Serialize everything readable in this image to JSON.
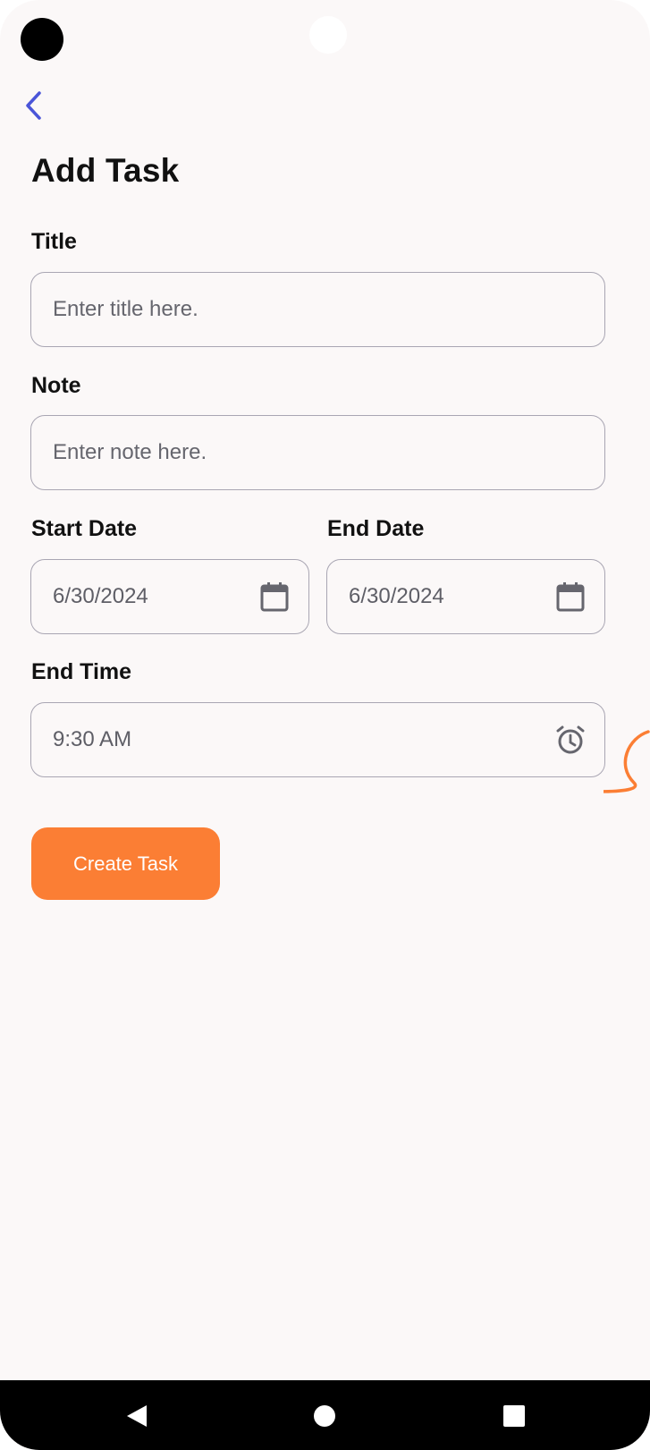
{
  "header": {
    "title": "Add Task"
  },
  "form": {
    "title": {
      "label": "Title",
      "placeholder": "Enter title here."
    },
    "note": {
      "label": "Note",
      "placeholder": "Enter note here."
    },
    "start_date": {
      "label": "Start Date",
      "value": "6/30/2024"
    },
    "end_date": {
      "label": "End Date",
      "value": "6/30/2024"
    },
    "end_time": {
      "label": "End Time",
      "value": "9:30 AM"
    },
    "submit_label": "Create Task"
  },
  "icons": {
    "back": "chevron-left-icon",
    "calendar": "calendar-icon",
    "alarm": "alarm-clock-icon",
    "nav_back": "triangle-back-icon",
    "nav_home": "circle-home-icon",
    "nav_recents": "square-recents-icon"
  },
  "colors": {
    "accent": "#fb7e34",
    "back_chevron": "#4a55d8",
    "background": "#fbf8f8",
    "field_border": "#a9a6b3"
  }
}
